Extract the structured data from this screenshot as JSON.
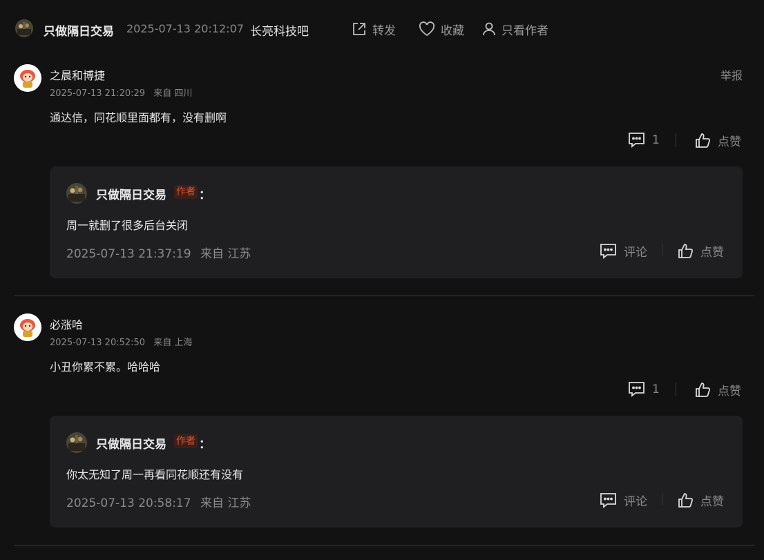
{
  "topbar": {
    "author": "只做隔日交易",
    "time": "2025-07-13 20:12:07",
    "bar_name": "长亮科技吧",
    "actions": {
      "share": "转发",
      "favorite": "收藏",
      "author_only": "只看作者"
    }
  },
  "comments": [
    {
      "name": "之晨和博捷",
      "time": "2025-07-13 21:20:29",
      "from": "来自 四川",
      "text": "通达信，同花顺里面都有，没有删啊",
      "report": "举报",
      "reply_count": "1",
      "like_label": "点赞",
      "reply": {
        "author": "只做隔日交易",
        "badge": "作者",
        "colon": "：",
        "text": "周一就删了很多后台关闭",
        "time": "2025-07-13 21:37:19",
        "from": "来自 江苏",
        "comment_label": "评论",
        "like_label": "点赞"
      }
    },
    {
      "name": "必涨哈",
      "time": "2025-07-13 20:52:50",
      "from": "来自 上海",
      "text": "小丑你累不累。哈哈哈",
      "report": "",
      "reply_count": "1",
      "like_label": "点赞",
      "reply": {
        "author": "只做隔日交易",
        "badge": "作者",
        "colon": "：",
        "text": "你太无知了周一再看同花顺还有没有",
        "time": "2025-07-13 20:58:17",
        "from": "来自 江苏",
        "comment_label": "评论",
        "like_label": "点赞"
      }
    }
  ],
  "colors": {
    "background": "#121212",
    "reply_bg": "#1f1f22",
    "author_badge": "#e0542e",
    "muted": "#8a8a8a"
  },
  "icons": [
    "share-icon",
    "heart-icon",
    "user-icon",
    "comment-icon",
    "thumbs-up-icon"
  ]
}
